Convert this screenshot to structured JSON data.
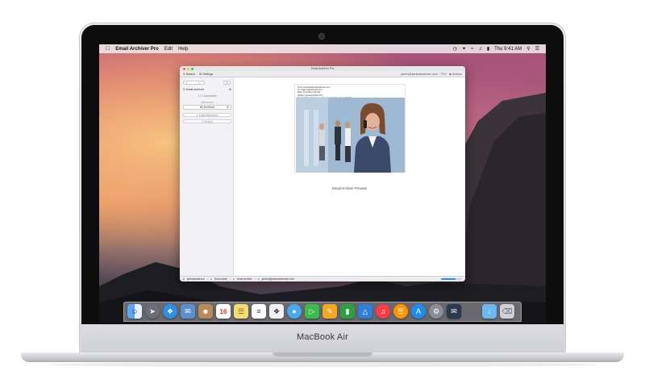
{
  "device": {
    "brand_label": "MacBook Air"
  },
  "menubar": {
    "app_name": "Email Archiver Pro",
    "items": [
      "Edit",
      "Help"
    ],
    "clock": "Thu 9:41 AM"
  },
  "window": {
    "title": "Email Archiver Pro",
    "toolbar": {
      "search_label": "Search",
      "settings_label": "Settings",
      "account_text": "james@jamesandersen.com · 77%",
      "archive_label": "Archive"
    },
    "sidebar": {
      "search_value": "email archiver",
      "count_text": "1 / 1 Documents",
      "section_heading": "ARCHIVES",
      "selected_archive": "All Archives",
      "field_one": "Email Addresses",
      "field_two": "Subject"
    },
    "main": {
      "preview_label": "Email Archiver Preview",
      "email_lines": [
        "From: james@jamesandersen.com",
        "To: support@example.com",
        "Date: Thursday 9:41 AM",
        "Subject: Email Archiver Pro",
        "Email Archiver Pro keeps all your mail safe and searchable."
      ]
    },
    "statusbar": {
      "path": [
        "jamesanderson",
        "Documents",
        "email archive",
        "james@jamesandersen.com"
      ],
      "progress": 0.7
    }
  },
  "dock": {
    "icons": [
      "finder-icon",
      "launchpad-icon",
      "safari-icon",
      "mail-stamp-icon",
      "contacts-icon",
      "calendar-icon",
      "notes-icon",
      "reminders-icon",
      "photo-booth-icon",
      "messages-icon",
      "facetime-icon",
      "pages-icon",
      "numbers-icon",
      "keynote-icon",
      "music-icon",
      "ibooks-icon",
      "app-store-icon",
      "system-preferences-icon",
      "email-archiver-icon",
      "downloads-folder-icon",
      "trash-icon"
    ],
    "calendar_day": "16"
  },
  "colors": {
    "close": "#ff5f57",
    "minimize": "#ffbd2e",
    "zoom": "#28c940",
    "accent": "#3a86e8"
  }
}
